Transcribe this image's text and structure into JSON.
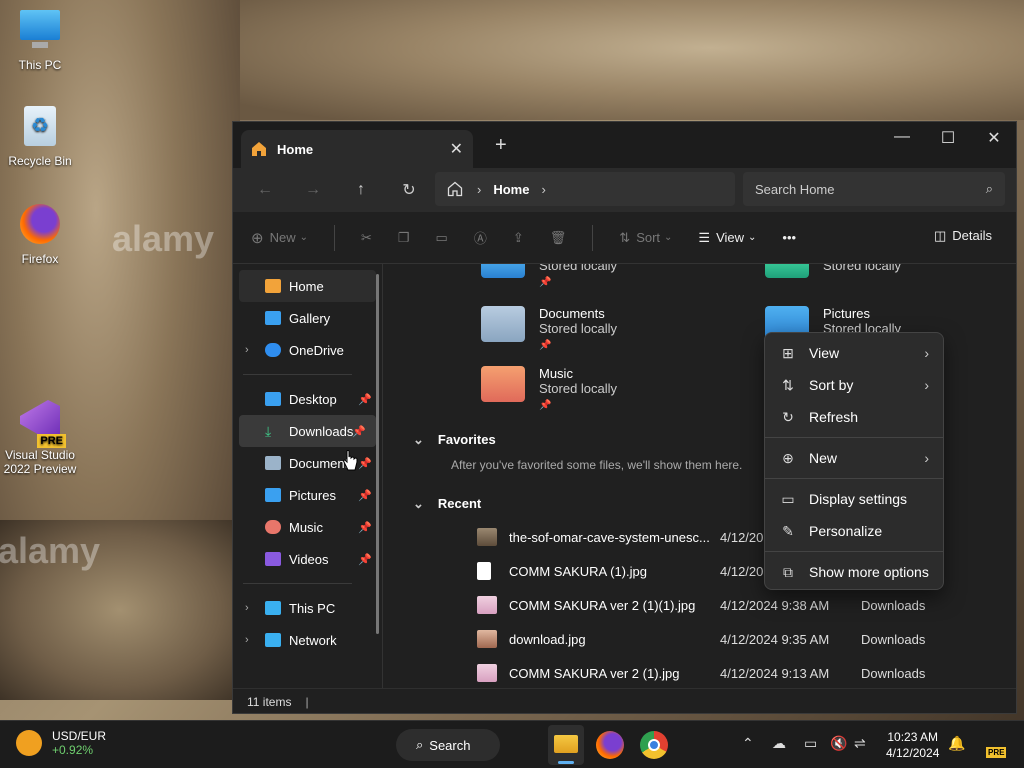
{
  "desktop": {
    "icons": [
      {
        "label": "This PC"
      },
      {
        "label": "Recycle Bin"
      },
      {
        "label": "Firefox"
      },
      {
        "label": "Visual Studio 2022 Preview"
      }
    ],
    "watermark": "alamy"
  },
  "window": {
    "tab_title": "Home",
    "address": {
      "segment": "Home"
    },
    "search_placeholder": "Search Home",
    "toolbar": {
      "new_label": "New",
      "sort_label": "Sort",
      "view_label": "View",
      "more_label": "•••",
      "details_label": "Details"
    },
    "sidebar": {
      "items": [
        {
          "label": "Home"
        },
        {
          "label": "Gallery"
        },
        {
          "label": "OneDrive"
        },
        {
          "label": "Desktop"
        },
        {
          "label": "Downloads"
        },
        {
          "label": "Documents"
        },
        {
          "label": "Pictures"
        },
        {
          "label": "Music"
        },
        {
          "label": "Videos"
        },
        {
          "label": "This PC"
        },
        {
          "label": "Network"
        }
      ]
    },
    "quick_access": [
      {
        "name": "",
        "sub": "Stored locally"
      },
      {
        "name": "",
        "sub": "Stored locally"
      },
      {
        "name": "Documents",
        "sub": "Stored locally"
      },
      {
        "name": "Pictures",
        "sub": "Stored locally"
      },
      {
        "name": "Music",
        "sub": "Stored locally"
      }
    ],
    "favorites": {
      "title": "Favorites",
      "hint": "After you've favorited some files, we'll show them here."
    },
    "recent": {
      "title": "Recent",
      "rows": [
        {
          "name": "the-sof-omar-cave-system-unesc...",
          "date": "4/12/20",
          "loc": ""
        },
        {
          "name": "COMM SAKURA (1).jpg",
          "date": "4/12/20",
          "loc": ""
        },
        {
          "name": "COMM SAKURA ver 2 (1)(1).jpg",
          "date": "4/12/2024 9:38 AM",
          "loc": "Downloads"
        },
        {
          "name": "download.jpg",
          "date": "4/12/2024 9:35 AM",
          "loc": "Downloads"
        },
        {
          "name": "COMM SAKURA ver 2 (1).jpg",
          "date": "4/12/2024 9:13 AM",
          "loc": "Downloads"
        }
      ]
    },
    "status": "11 items"
  },
  "context_menu": {
    "items": [
      {
        "label": "View"
      },
      {
        "label": "Sort by"
      },
      {
        "label": "Refresh"
      },
      {
        "label": "New"
      },
      {
        "label": "Display settings"
      },
      {
        "label": "Personalize"
      },
      {
        "label": "Show more options"
      }
    ]
  },
  "taskbar": {
    "stock_name": "USD/EUR",
    "stock_change": "+0.92%",
    "search_label": "Search",
    "time": "10:23 AM",
    "date": "4/12/2024"
  }
}
